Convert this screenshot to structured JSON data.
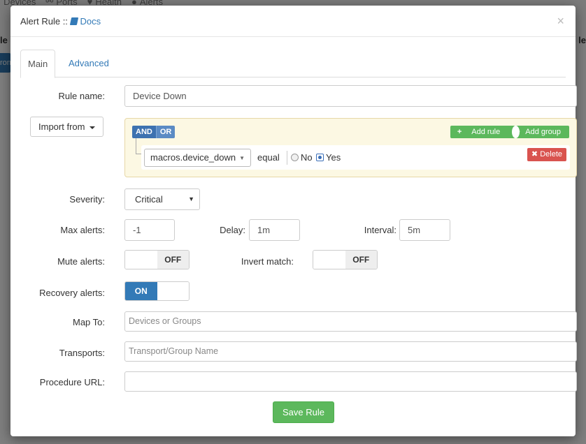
{
  "background": {
    "nav_items": [
      {
        "label": "Devices"
      },
      {
        "label": "Ports"
      },
      {
        "label": "Health"
      },
      {
        "label": "Alerts"
      }
    ],
    "left_fragment": "le",
    "right_fragment": "le",
    "blue_button_fragment": "ron"
  },
  "modal": {
    "title_prefix": "Alert Rule ::",
    "docs_label": "Docs",
    "close_glyph": "×",
    "tabs": [
      {
        "label": "Main",
        "active": true
      },
      {
        "label": "Advanced",
        "active": false
      }
    ],
    "rule_name": {
      "label": "Rule name:",
      "value": "Device Down"
    },
    "import_button": "Import from",
    "query_builder": {
      "and_label": "AND",
      "or_label": "OR",
      "add_rule_label": "Add rule",
      "add_group_label": "Add group",
      "rule": {
        "field": "macros.device_down",
        "operator": "equal",
        "options": [
          {
            "label": "No",
            "selected": false
          },
          {
            "label": "Yes",
            "selected": true
          }
        ],
        "delete_label": "Delete"
      }
    },
    "severity": {
      "label": "Severity:",
      "value": "Critical"
    },
    "max_alerts": {
      "label": "Max alerts:",
      "value": "-1"
    },
    "delay": {
      "label": "Delay:",
      "value": "1m"
    },
    "interval": {
      "label": "Interval:",
      "value": "5m"
    },
    "mute_alerts": {
      "label": "Mute alerts:",
      "state": "OFF"
    },
    "invert_match": {
      "label": "Invert match:",
      "state": "OFF"
    },
    "recovery_alerts": {
      "label": "Recovery alerts:",
      "state": "ON"
    },
    "map_to": {
      "label": "Map To:",
      "placeholder": "Devices or Groups"
    },
    "transports": {
      "label": "Transports:",
      "placeholder": "Transport/Group Name"
    },
    "procedure_url": {
      "label": "Procedure URL:",
      "value": ""
    },
    "save_button": "Save Rule"
  },
  "colors": {
    "primary": "#337ab7",
    "success": "#5cb85c",
    "danger": "#d9534f",
    "query_bg": "#fcf8e3"
  },
  "icons": [
    "book-icon",
    "close-icon",
    "caret-down-icon",
    "plus-icon",
    "plus-circle-icon",
    "times-icon"
  ]
}
